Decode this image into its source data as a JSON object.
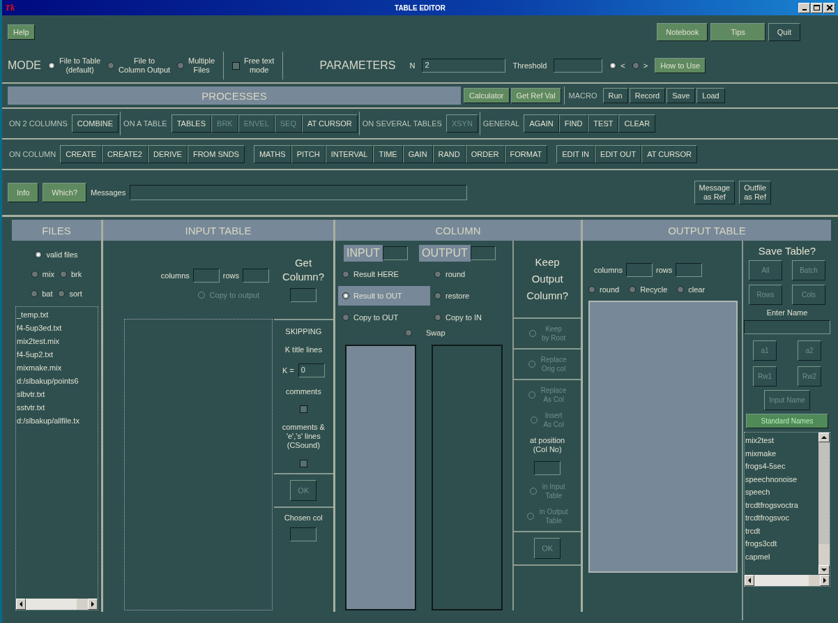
{
  "window": {
    "title": "TABLE EDITOR",
    "logo": "Tk"
  },
  "top_left": [
    {
      "label": "Help",
      "kind": "green"
    }
  ],
  "top_right": [
    {
      "label": "Notebook",
      "kind": "green"
    },
    {
      "label": "Tips",
      "kind": "green"
    },
    {
      "label": "Quit",
      "kind": "plain"
    }
  ],
  "mode": {
    "label": "MODE",
    "options": [
      {
        "label": "File to Table\n(default)",
        "selected": true
      },
      {
        "label": "File to\nColumn Output",
        "selected": false
      },
      {
        "label": "Multiple\nFiles",
        "selected": false
      }
    ],
    "free_text": {
      "label": "Free text\nmode",
      "checked": false
    }
  },
  "parameters": {
    "label": "PARAMETERS",
    "n_label": "N",
    "n_value": "2",
    "threshold_label": "Threshold",
    "compare": [
      {
        "label": "<",
        "selected": true
      },
      {
        "label": ">",
        "selected": false
      }
    ],
    "how_to_use": "How to Use"
  },
  "processes": {
    "title": "PROCESSES",
    "buttons": [
      "Calculator",
      "Get Ref Val"
    ],
    "macro_label": "MACRO",
    "macro_buttons": [
      "Run",
      "Record",
      "Save",
      "Load"
    ]
  },
  "process_rows": [
    {
      "groups": [
        {
          "label": "ON 2 COLUMNS",
          "buttons": [
            {
              "label": "COMBINE",
              "disabled": false
            }
          ]
        },
        {
          "label": "ON A TABLE",
          "buttons": [
            {
              "label": "TABLES",
              "disabled": false
            },
            {
              "label": "BRK",
              "disabled": true
            },
            {
              "label": "ENVEL",
              "disabled": true
            },
            {
              "label": "SEQ",
              "disabled": true
            },
            {
              "label": "AT CURSOR",
              "disabled": false
            }
          ]
        },
        {
          "label": "ON SEVERAL TABLES",
          "buttons": [
            {
              "label": "XSYN",
              "disabled": true
            }
          ]
        },
        {
          "label": "GENERAL",
          "buttons": [
            {
              "label": "AGAIN",
              "disabled": false
            },
            {
              "label": "FIND",
              "disabled": false
            },
            {
              "label": "TEST",
              "disabled": false
            },
            {
              "label": "CLEAR",
              "disabled": false
            }
          ]
        }
      ]
    },
    {
      "groups": [
        {
          "label": "ON COLUMN",
          "buttons": [
            {
              "label": "CREATE",
              "disabled": false
            },
            {
              "label": "CREATE2",
              "disabled": false
            },
            {
              "label": "DERIVE",
              "disabled": false
            },
            {
              "label": "FROM SNDS",
              "disabled": false
            }
          ]
        },
        {
          "buttons": [
            {
              "label": "MATHS",
              "disabled": false
            },
            {
              "label": "PITCH",
              "disabled": false
            },
            {
              "label": "INTERVAL",
              "disabled": false
            },
            {
              "label": "TIME",
              "disabled": false
            },
            {
              "label": "GAIN",
              "disabled": false
            },
            {
              "label": "RAND",
              "disabled": false
            },
            {
              "label": "ORDER",
              "disabled": false
            },
            {
              "label": "FORMAT",
              "disabled": false
            }
          ]
        },
        {
          "buttons": [
            {
              "label": "EDIT IN",
              "disabled": false
            },
            {
              "label": "EDIT OUT",
              "disabled": false
            },
            {
              "label": "AT CURSOR",
              "disabled": false
            }
          ]
        }
      ]
    }
  ],
  "messages": {
    "buttons": [
      "Info",
      "Which?"
    ],
    "label": "Messages",
    "ref_buttons": [
      "Message\nas Ref",
      "Outfile\nas Ref"
    ]
  },
  "files": {
    "title": "FILES",
    "filters": [
      [
        {
          "label": "valid files",
          "selected": true
        }
      ],
      [
        {
          "label": "mix",
          "selected": false
        },
        {
          "label": "brk",
          "selected": false
        }
      ],
      [
        {
          "label": "bat",
          "selected": false
        },
        {
          "label": "sort",
          "selected": false
        }
      ]
    ],
    "list": [
      "_temp.txt",
      "f4-5up3ed.txt",
      "mix2test.mix",
      "f4-5up2.txt",
      "mixmake.mix",
      "d:/slbakup/points6",
      "slbvtr.txt",
      "sstvtr.txt",
      "d:/slbakup/allfile.tx"
    ]
  },
  "input_table": {
    "title": "INPUT TABLE",
    "columns_label": "columns",
    "rows_label": "rows",
    "get_column": "Get\nColumn?",
    "copy_to_output": {
      "label": "Copy to output",
      "disabled": true
    },
    "skipping": "SKIPPING",
    "k_title": "K title lines",
    "k_label": "K =",
    "k_value": "0",
    "comments": {
      "label": "comments",
      "checked": false
    },
    "csound": {
      "label": "comments &\n'e','s' lines\n(CSound)",
      "checked": false
    },
    "ok": {
      "label": "OK",
      "disabled": true
    },
    "chosen_col": "Chosen col"
  },
  "column": {
    "title": "COLUMN",
    "input_label": "INPUT",
    "output_label": "OUTPUT",
    "left_options": [
      {
        "label": "Result HERE",
        "selected": false
      },
      {
        "label": "Result to OUT",
        "selected": true
      },
      {
        "label": "Copy to OUT",
        "selected": false
      }
    ],
    "right_options": [
      {
        "label": "round",
        "selected": false
      },
      {
        "label": "restore",
        "selected": false
      },
      {
        "label": "Copy to IN",
        "selected": false
      }
    ],
    "swap": {
      "label": "Swap",
      "selected": false
    },
    "keep_title": "Keep\nOutput\nColumn?",
    "keep_sections": [
      {
        "items": [
          {
            "kind": "radio",
            "label": "Keep\nby Root",
            "disabled": true
          }
        ]
      },
      {
        "items": [
          {
            "kind": "radio",
            "label": "Replace\nOrig col",
            "disabled": true
          }
        ]
      },
      {
        "items": [
          {
            "kind": "radio",
            "label": "Replace\nAs Col",
            "disabled": true
          },
          {
            "kind": "radio",
            "label": "Insert\nAs Col",
            "disabled": true
          },
          {
            "kind": "position",
            "label": "at position\n(Col No)"
          },
          {
            "kind": "radio",
            "label": "in Input\nTable",
            "disabled": true
          },
          {
            "kind": "radio",
            "label": "in Output\nTable",
            "disabled": true
          }
        ]
      },
      {
        "items": [
          {
            "kind": "button",
            "label": "OK",
            "disabled": true
          }
        ]
      }
    ]
  },
  "output_table": {
    "title": "OUTPUT TABLE",
    "columns_label": "columns",
    "rows_label": "rows",
    "modes": [
      {
        "label": "round",
        "selected": false
      },
      {
        "label": "Recycle",
        "selected": false
      },
      {
        "label": "clear",
        "selected": false
      }
    ],
    "save_title": "Save Table?",
    "save_buttons": [
      {
        "label": "All",
        "disabled": true
      },
      {
        "label": "Batch",
        "disabled": true
      },
      {
        "label": "Rows",
        "disabled": true
      },
      {
        "label": "Cols",
        "disabled": true
      }
    ],
    "enter_name": "Enter Name",
    "name_buttons": [
      {
        "label": "a1",
        "disabled": true
      },
      {
        "label": "a2",
        "disabled": true
      },
      {
        "label": "Rw1",
        "disabled": true
      },
      {
        "label": "Rw2",
        "disabled": true
      }
    ],
    "input_name": {
      "label": "Input Name",
      "disabled": true
    },
    "standard_names": {
      "label": "Standard Names",
      "disabled": true
    },
    "names": [
      "mix2test",
      "mixmake",
      "frogs4-5sec",
      "speechnonoise",
      "speech",
      "trcdtfrogsvoctra",
      "trcdtfrogsvoc",
      "trcdt",
      "frogs3cdt",
      "capmel"
    ]
  }
}
